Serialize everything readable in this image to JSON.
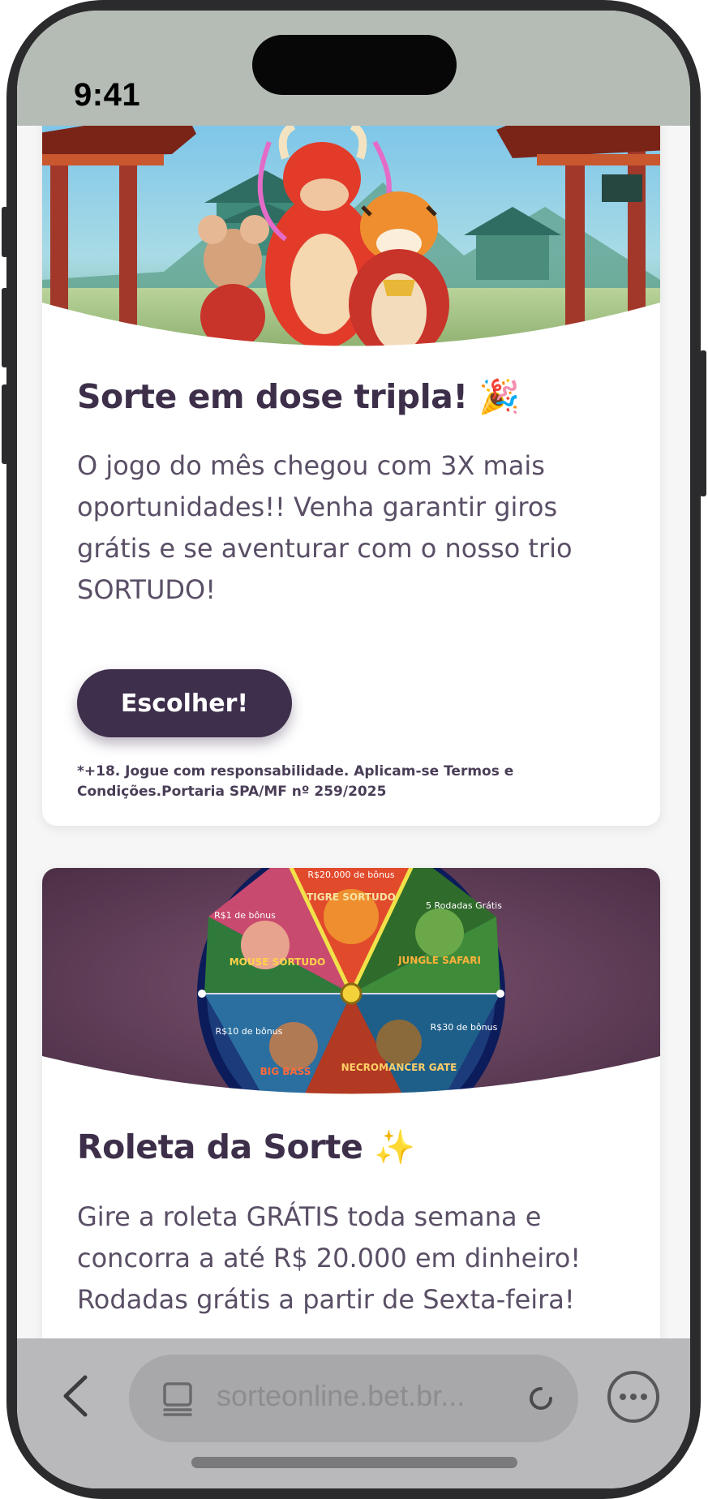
{
  "status_bar": {
    "time": "9:41"
  },
  "cards": [
    {
      "title": "Sorte em dose tripla! 🎉",
      "body": "O jogo do mês chegou com 3X mais oportunidades!! Venha garantir giros grátis e se aventurar com o nosso trio SORTUDO!",
      "button_label": "Escolher!",
      "disclaimer": "*+18. Jogue com responsabilidade. Aplicam-se Termos e Condições.Portaria SPA/MF nº 259/2025"
    },
    {
      "title": "Roleta da Sorte ✨",
      "body": "Gire a roleta GRÁTIS toda semana e concorra a até R$ 20.000 em dinheiro! Rodadas grátis a partir de Sexta-feira!",
      "wheel_segments": [
        "R$20.000 de bônus",
        "R$1 de bônus",
        "5 Rodadas Grátis",
        "R$30 de bônus",
        "R$10 de bônus"
      ],
      "wheel_games": [
        "TIGRE SORTUDO",
        "MOUSE SORTUDO",
        "JUNGLE SAFARI",
        "BIG BASS",
        "NECROMANCER GATE"
      ]
    }
  ],
  "browser": {
    "url": "sorteonline.bet.br...",
    "icons": [
      "back-chevron-icon",
      "reader-icon",
      "reload-icon",
      "more-icon"
    ]
  },
  "colors": {
    "brand_purple": "#3e2f4c",
    "title_text": "#3d2f4a",
    "body_text": "#5a4f66",
    "status_bar_bg": "#b5bcb5",
    "browser_bar_bg": "#b9b9bc"
  }
}
